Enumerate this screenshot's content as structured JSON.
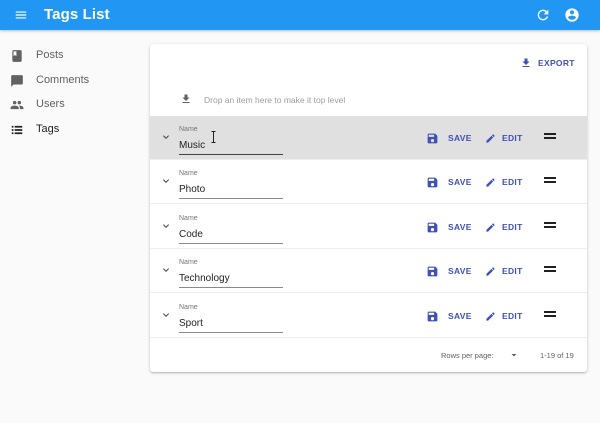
{
  "appbar": {
    "title": "Tags List",
    "menu_icon": "menu-icon",
    "refresh_icon": "refresh-icon",
    "account_icon": "account-circle-icon",
    "color": "#2196f3"
  },
  "sidebar": {
    "items": [
      {
        "label": "Posts",
        "icon": "book-icon"
      },
      {
        "label": "Comments",
        "icon": "chat-icon"
      },
      {
        "label": "Users",
        "icon": "people-icon"
      },
      {
        "label": "Tags",
        "icon": "list-icon",
        "active": true
      }
    ]
  },
  "toolbar": {
    "export_label": "EXPORT",
    "export_icon": "download-icon"
  },
  "drop_zone": {
    "text": "Drop an item here to make it top level",
    "icon": "download-icon"
  },
  "rows": [
    {
      "field_label": "Name",
      "value": "Music",
      "save_label": "SAVE",
      "edit_label": "EDIT",
      "selected": true
    },
    {
      "field_label": "Name",
      "value": "Photo",
      "save_label": "SAVE",
      "edit_label": "EDIT"
    },
    {
      "field_label": "Name",
      "value": "Code",
      "save_label": "SAVE",
      "edit_label": "EDIT"
    },
    {
      "field_label": "Name",
      "value": "Technology",
      "save_label": "SAVE",
      "edit_label": "EDIT"
    },
    {
      "field_label": "Name",
      "value": "Sport",
      "save_label": "SAVE",
      "edit_label": "EDIT"
    }
  ],
  "pagination": {
    "rows_per_page_label": "Rows per page:",
    "range": "1-19 of 19"
  },
  "colors": {
    "accent": "#3f51b5",
    "selected_row": "#e0e0e0"
  }
}
